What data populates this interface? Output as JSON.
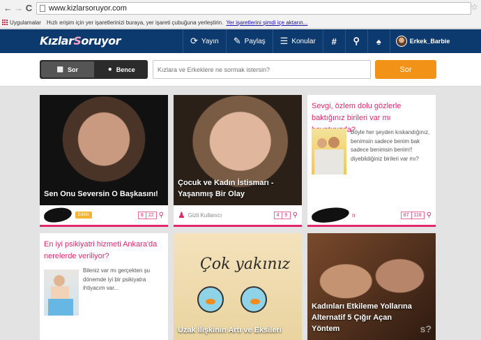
{
  "browser": {
    "url": "www.kizlarsoruyor.com",
    "bookmarks_apps": "Uygulamalar",
    "bookmarks_message": "Hızlı erişim için yer işaretlerinizi buraya, yer işareti çubuğuna yerleştirin.",
    "bookmarks_import_link": "Yer işaretlerini şimdi içe aktarın..."
  },
  "site": {
    "logo": "KızlarSoruyor",
    "nav": [
      {
        "label": "Yayın",
        "icon": "broadcast-icon"
      },
      {
        "label": "Paylaş",
        "icon": "edit-icon"
      },
      {
        "label": "Konular",
        "icon": "stack-icon"
      }
    ],
    "hash": "#",
    "username": "Erkek_Barbie"
  },
  "ask": {
    "tab_sor": "Sor",
    "tab_bence": "Bence",
    "placeholder": "Kızlara ve Erkeklere ne sormak istersin?",
    "button": "Sor"
  },
  "cards": [
    {
      "title": "Sen Onu Seversin O Başkasını!",
      "badge": "Editör",
      "count1": "8",
      "count2": "22",
      "image": "man-portrait"
    },
    {
      "title": "Çocuk ve Kadın İstismarı - Yaşanmış Bir Olay",
      "user": "Gizli Kullanıcı",
      "count1": "4",
      "count2": "9",
      "image": "girl-covered-mouth"
    },
    {
      "title": "Sevgi, özlem dolu gözlerle baktığınız birileri var mı hayatınızda?",
      "body": "Böyle her şeyden kıskandığınız, benimsin sadece benim bak sadece benimsin benim!! diyebildiğiniz birileri var mı?",
      "count1": "87",
      "count2": "118",
      "user_suffix": "n",
      "image": "couple"
    },
    {
      "title": "En iyi psikiyatri hizmeti Ankara'da nerelerde veriliyor?",
      "body": "Bileniz var mı gerçekten şu dönemde iyi bir psikiyatra ihtiyacım var...",
      "image": "woman-sitting"
    },
    {
      "title": "Uzak İlişkinin Artı ve Eksileri",
      "image_text": "Çok yakınız",
      "image": "fishbowls"
    },
    {
      "title": "Kadınları Etkileme Yollarına Alternatif 5 Çığır Açan Yöntem",
      "image_suffix": "s?",
      "image": "two-men"
    }
  ]
}
